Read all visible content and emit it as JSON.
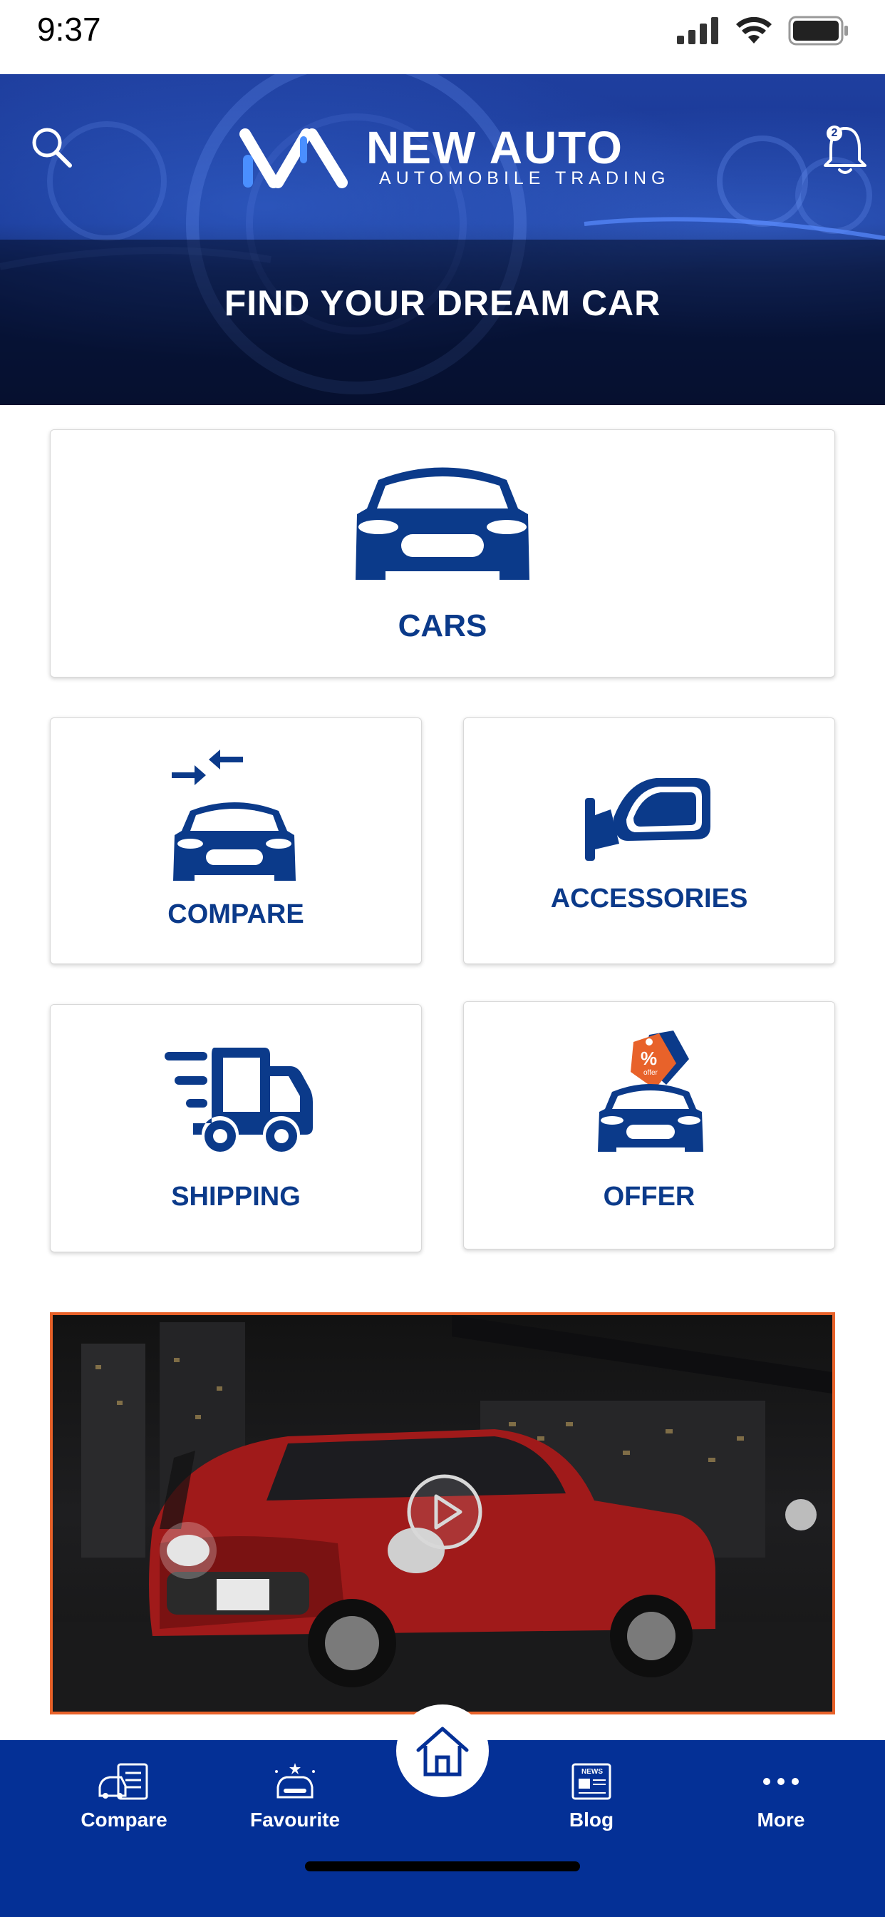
{
  "status_bar": {
    "time": "9:37"
  },
  "header": {
    "logo_name": "NEW AUTO",
    "logo_subtitle": "AUTOMOBILE TRADING",
    "notification_count": "2",
    "hero_title": "FIND YOUR DREAM CAR"
  },
  "categories": {
    "cars": "CARS",
    "compare": "COMPARE",
    "accessories": "ACCESSORIES",
    "shipping": "SHIPPING",
    "offer": "OFFER",
    "offer_tag_symbol": "%",
    "offer_tag_text": "offer"
  },
  "bottom_nav": {
    "compare": "Compare",
    "favourite": "Favourite",
    "blog": "Blog",
    "blog_icon_text": "NEWS",
    "more": "More"
  },
  "colors": {
    "brand_blue": "#043096",
    "icon_blue": "#0b3a8a",
    "accent_orange": "#e8622a"
  }
}
